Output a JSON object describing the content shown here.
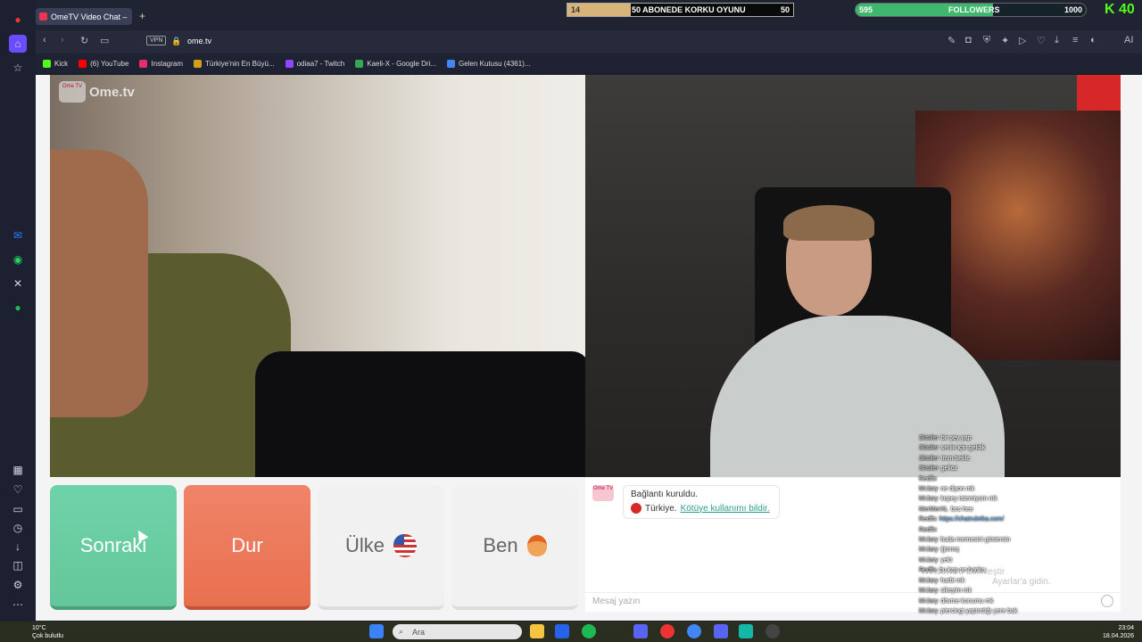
{
  "browser": {
    "tab_title": "OmeTV Video Chat –",
    "url": "ome.tv",
    "vpn_label": "VPN",
    "bookmarks": [
      {
        "label": "Kick",
        "color": "#53fc18"
      },
      {
        "label": "(6) YouTube",
        "color": "#ff0000"
      },
      {
        "label": "Instagram",
        "color": "#e1306c"
      },
      {
        "label": "Türkiye'nin En Büyü...",
        "color": "#d4a017"
      },
      {
        "label": "odiaa7 - Twitch",
        "color": "#9146ff"
      },
      {
        "label": "Kaeli-X - Google Dri...",
        "color": "#34a853"
      },
      {
        "label": "Gelen Kutusu (4361)...",
        "color": "#4285f4"
      }
    ]
  },
  "overlays": {
    "goal_left_value": "14",
    "goal_title": "50 ABONEDE KORKU OYUNU",
    "goal_right_value": "50",
    "goal_progress": 0.28,
    "followers_left": "595",
    "followers_label": "FOLLOWERS",
    "followers_right": "1000",
    "followers_progress": 0.595,
    "kick_count": "40"
  },
  "ometv": {
    "logo_small": "Ome TV",
    "logo_text": "Ome.tv",
    "buttons": {
      "next": "Sonraki",
      "stop": "Dur",
      "country": "Ülke",
      "me": "Ben"
    },
    "system_message": {
      "icon_label": "Ome TV",
      "connected": "Bağlantı kuruldu.",
      "country": "Türkiye.",
      "report_link": "Kötüye kullanımı bildir."
    },
    "input_placeholder": "Mesaj yazın"
  },
  "stream_chat": [
    {
      "user": "3kisiler",
      "text": "bir şey yap"
    },
    {
      "user": "3kisiler",
      "text": "senin için geldik"
    },
    {
      "user": "3kisiler",
      "text": "tmm bekle"
    },
    {
      "user": "3kisiler",
      "text": "gelioz"
    },
    {
      "user": "Redfix",
      "text": ""
    },
    {
      "user": "MrJary",
      "text": "ne diyon mk"
    },
    {
      "user": "MrJary",
      "text": "kopey istemiyom mk"
    },
    {
      "user": "MerMerXL",
      "text": "bos hee"
    },
    {
      "user": "Redfix",
      "text": "https://chatruletka.com/",
      "link": true
    },
    {
      "user": "Redfix",
      "text": ""
    },
    {
      "user": "MrJary",
      "text": "buda memesini göstersin"
    },
    {
      "user": "MrJary",
      "text": "ijjmmq"
    },
    {
      "user": "MrJary",
      "text": "yekt"
    },
    {
      "user": "Redfix",
      "text": "bu kaş ne banka"
    },
    {
      "user": "MrJary",
      "text": "harbi mk"
    },
    {
      "user": "MrJary",
      "text": "sikeyim mk"
    },
    {
      "user": "MrJary",
      "text": "dövme konumu mk"
    },
    {
      "user": "MrJary",
      "text": "piercingi yaptırdığı yere bak"
    }
  ],
  "windows": {
    "watermark": "Windows'u Etkinleştir",
    "watermark2": "Ayarlar'a gidin.",
    "search_label": "Ara",
    "weather_temp": "10°C",
    "weather_desc": "Çok bulutlu",
    "time": "23:04",
    "date": "18.04.2026"
  }
}
